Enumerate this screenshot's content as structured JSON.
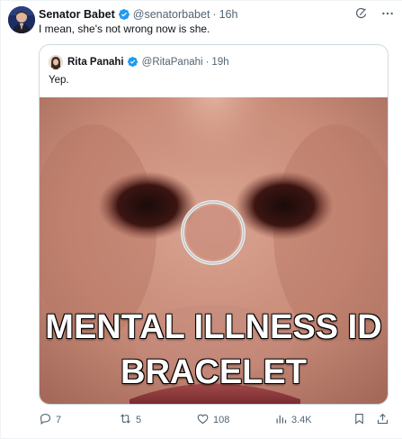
{
  "tweet": {
    "author_name": "Senator Babet",
    "author_handle": "@senatorbabet",
    "separator": "·",
    "time": "16h",
    "text": "I mean, she's not wrong now is she."
  },
  "quote": {
    "author_name": "Rita Panahi",
    "author_handle": "@RitaPanahi",
    "separator": "·",
    "time": "19h",
    "text": "Yep.",
    "meme_line1": "MENTAL ILLNESS ID",
    "meme_line2": "BRACELET"
  },
  "actions": {
    "replies": "7",
    "retweets": "5",
    "likes": "108",
    "views": "3.4K"
  },
  "colors": {
    "verified": "#1d9bf0",
    "secondary_text": "#536471",
    "border": "#cfd9de"
  },
  "icons": [
    "verified-badge-icon",
    "grok-icon",
    "more-icon",
    "reply-icon",
    "retweet-icon",
    "like-icon",
    "views-icon",
    "bookmark-icon",
    "share-icon"
  ]
}
